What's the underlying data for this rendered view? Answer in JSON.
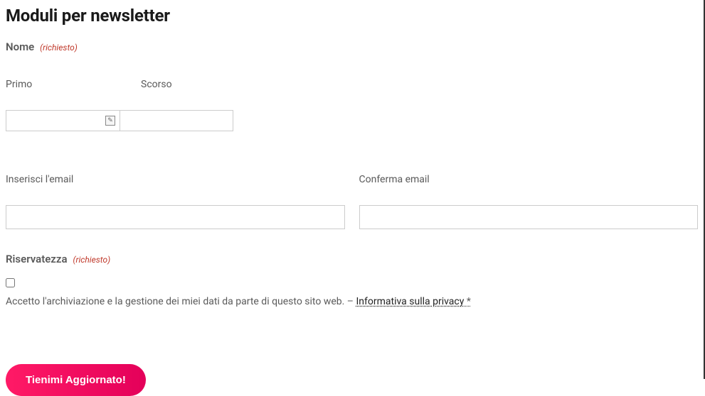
{
  "title": "Moduli per newsletter",
  "name_field": {
    "label": "Nome",
    "required_text": "(richiesto)",
    "first_label": "Primo",
    "last_label": "Scorso"
  },
  "email_field": {
    "enter_label": "Inserisci l'email",
    "confirm_label": "Conferma email"
  },
  "privacy": {
    "label": "Riservatezza",
    "required_text": "(richiesto)",
    "consent_text": "Accetto l'archiviazione e la gestione dei miei dati da parte di questo sito web. – ",
    "link_text": "Informativa sulla privacy",
    "asterisk": " *"
  },
  "submit_label": "Tienimi Aggiornato!"
}
